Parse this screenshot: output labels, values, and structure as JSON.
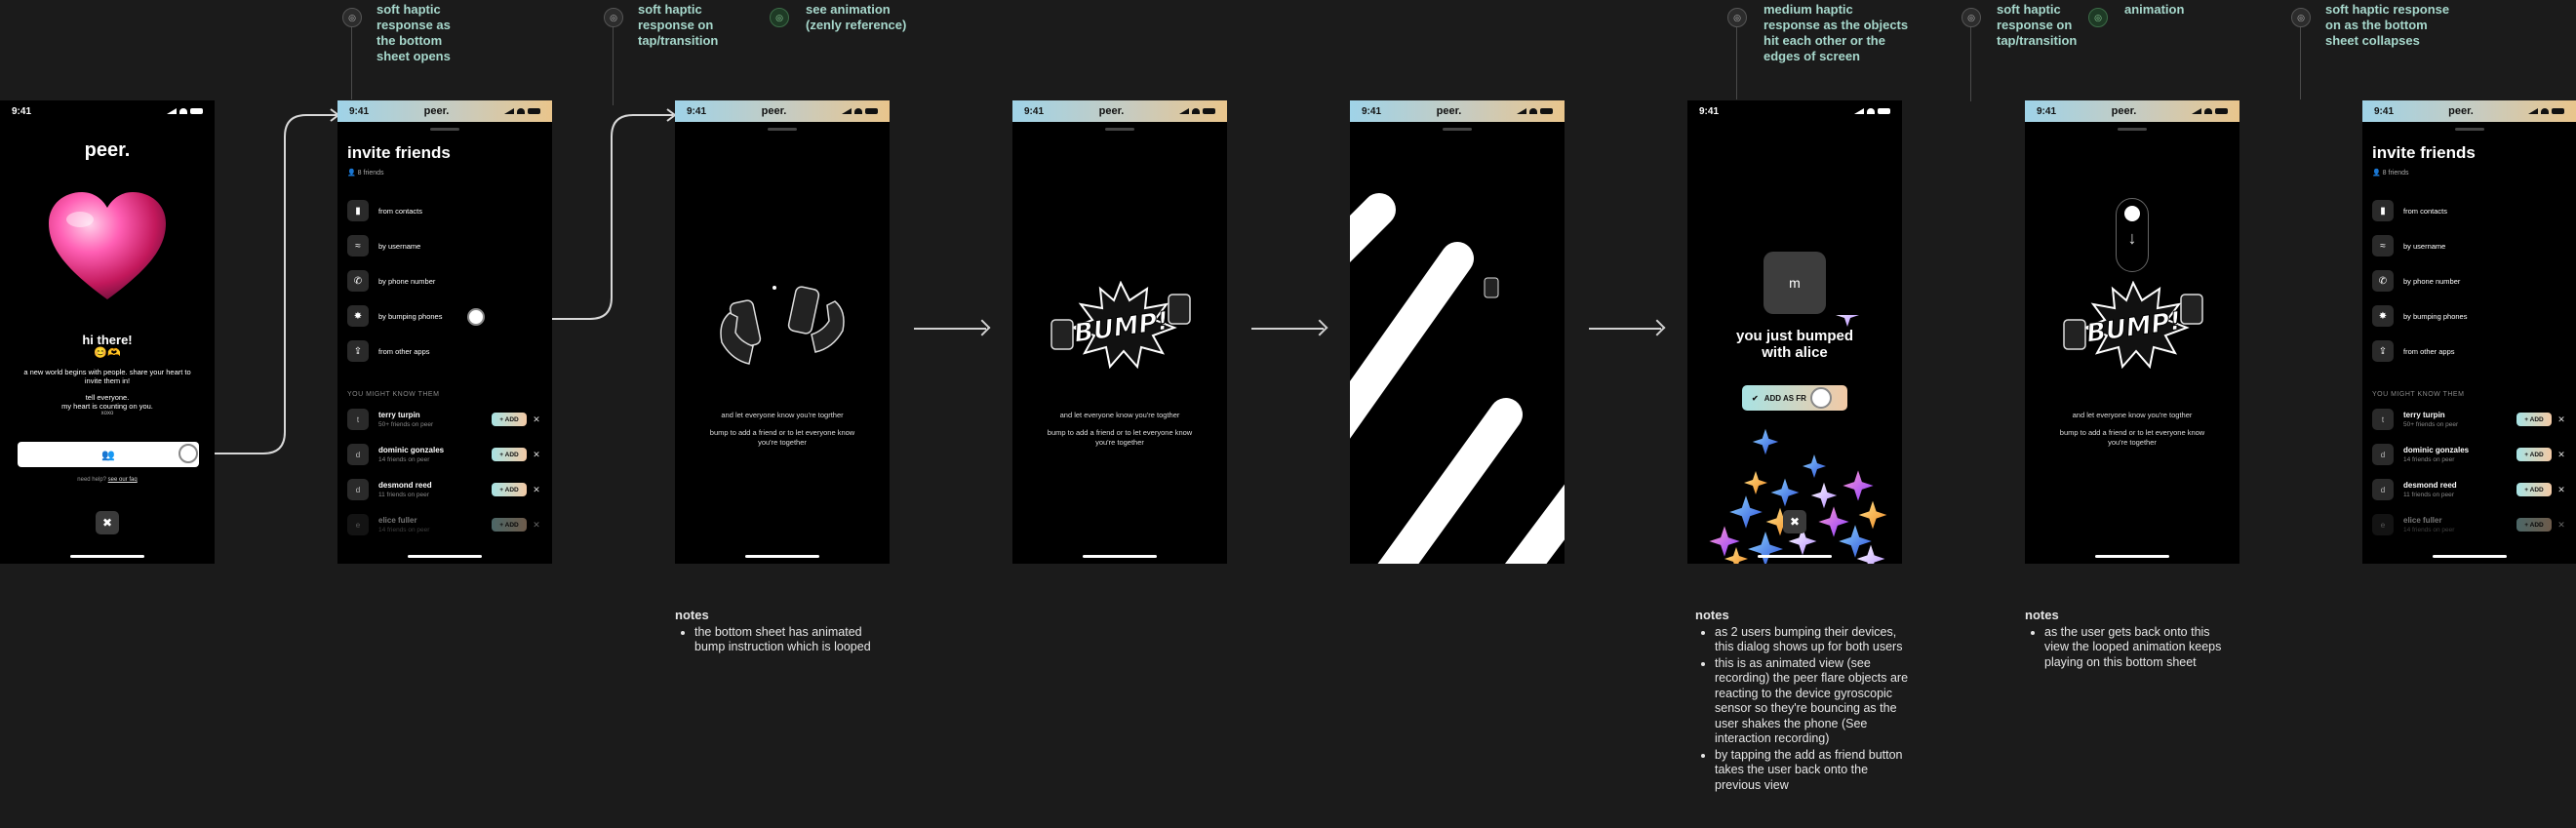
{
  "status_time": "9:41",
  "brand": "peer.",
  "annotations": [
    {
      "text": "soft haptic response as the bottom sheet opens",
      "lines": [
        "soft haptic",
        "response as",
        "the bottom",
        "sheet opens"
      ]
    },
    {
      "text": "soft haptic response on tap/transition",
      "lines": [
        "soft haptic",
        "response on",
        "tap/transition"
      ]
    },
    {
      "text": "see animation (zenly reference)",
      "lines": [
        "see animation",
        "(zenly reference)"
      ]
    },
    {
      "text": "medium haptic response as the objects hit each other or the edges of screen",
      "lines": [
        "medium haptic",
        "response as the objects",
        "hit each other or the",
        "edges of screen"
      ]
    },
    {
      "text": "soft haptic response on tap/transition",
      "lines": [
        "soft haptic",
        "response on",
        "tap/transition"
      ]
    },
    {
      "text": "animation",
      "lines": [
        "animation"
      ]
    },
    {
      "text": "soft haptic response on as the bottom sheet collapses",
      "lines": [
        "soft haptic response",
        "on as the bottom",
        "sheet collapses"
      ]
    }
  ],
  "welcome": {
    "greeting": "hi there!",
    "emoji": "😊🫶",
    "line1": "a new world begins with people. share your heart to invite them in!",
    "line2": "tell everyone.",
    "line3": "my heart is counting on you.",
    "line4": "xoxo",
    "help": "need help?",
    "help_link": "see our faq"
  },
  "invite": {
    "title": "invite friends",
    "count": "8 friends",
    "options": [
      "from contacts",
      "by username",
      "by phone number",
      "by bumping phones",
      "from other apps"
    ],
    "section": "YOU MIGHT KNOW THEM",
    "add_label": "+ ADD",
    "friends": [
      {
        "initial": "t",
        "name": "terry turpin",
        "sub": "50+ friends on peer"
      },
      {
        "initial": "d",
        "name": "dominic gonzales",
        "sub": "14 friends on peer"
      },
      {
        "initial": "d",
        "name": "desmond reed",
        "sub": "11 friends on peer"
      },
      {
        "initial": "e",
        "name": "elice fuller",
        "sub": "14 friends on peer"
      }
    ]
  },
  "bump_sheet": {
    "line1": "and let everyone know you're togrther",
    "line1_b": "and let everyone know you're togther",
    "line2": "bump to add a friend or to let everyone know you're together",
    "bump_word": "BUMP!",
    "partial_word": "P!"
  },
  "result": {
    "avatar": "m",
    "message": "you just bumped with alice",
    "add_button": "ADD AS FR"
  },
  "notes": [
    {
      "title": "notes",
      "items": [
        "the bottom sheet has animated bump instruction which is looped"
      ]
    },
    {
      "title": "notes",
      "items": [
        "as 2 users bumping their devices, this dialog shows up for both users",
        "this is as animated view (see recording) the peer flare objects are reacting to the device gyroscopic sensor so they're bouncing as the user shakes the phone (See interaction recording)",
        "by tapping the add as friend button takes the user back onto the previous view"
      ]
    },
    {
      "title": "notes",
      "items": [
        "as the user gets back onto this view the looped animation keeps playing on this bottom sheet"
      ]
    }
  ],
  "colors": {
    "background": "#1b1b1b",
    "accent_teal": "#a7d8cc",
    "accent_peach": "#e9b4a0",
    "add_gradient_start": "#a8e3e4",
    "add_gradient_end": "#f2c9a5"
  },
  "icons": [
    "soft-haptic-icon",
    "animation-icon",
    "heart-icon",
    "contacts-icon",
    "user-icon",
    "phone-icon",
    "bump-icon",
    "share-icon",
    "close-icon",
    "check-icon",
    "star-icon"
  ]
}
